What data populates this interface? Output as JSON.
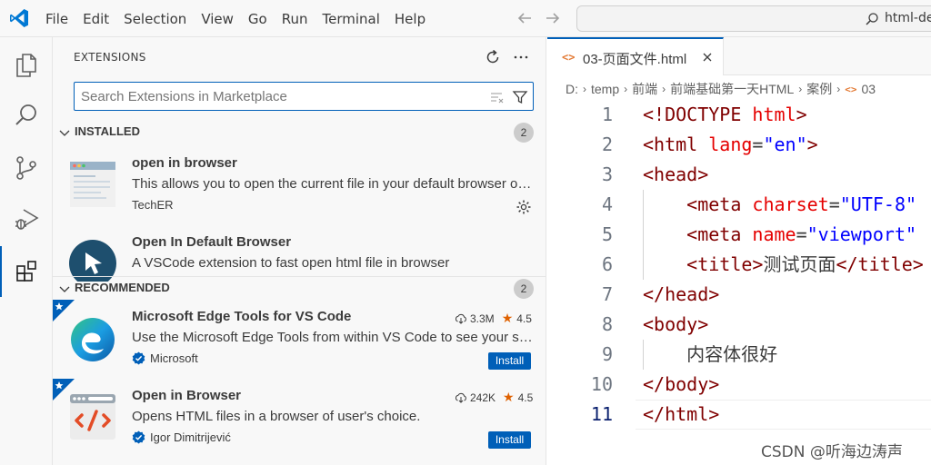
{
  "colors": {
    "accent": "#005fb8",
    "tag": "#800000",
    "attribute": "#e50000",
    "string": "#0000ff",
    "star": "#df6100"
  },
  "titlebar": {
    "menu": [
      "File",
      "Edit",
      "Selection",
      "View",
      "Go",
      "Run",
      "Terminal",
      "Help"
    ],
    "command_center_text": "html-de"
  },
  "activity_bar": [
    "explorer-icon",
    "search-icon",
    "source-control-icon",
    "run-debug-icon",
    "extensions-icon"
  ],
  "sidebar": {
    "title": "EXTENSIONS",
    "search_placeholder": "Search Extensions in Marketplace",
    "installed": {
      "title": "INSTALLED",
      "count": "2",
      "items": [
        {
          "name": "open in browser",
          "description": "This allows you to open the current file in your default browser or application.",
          "publisher": "TechER"
        },
        {
          "name": "Open In Default Browser",
          "description": "A VSCode extension to fast open html file in browser",
          "publisher": ""
        }
      ]
    },
    "recommended": {
      "title": "RECOMMENDED",
      "count": "2",
      "items": [
        {
          "name": "Microsoft Edge Tools for VS Code",
          "description": "Use the Microsoft Edge Tools from within VS Code to see your site's runtime HTML structure",
          "publisher": "Microsoft",
          "downloads": "3.3M",
          "rating": "4.5",
          "button": "Install"
        },
        {
          "name": "Open in Browser",
          "description": "Opens HTML files in a browser of user's choice.",
          "publisher": "Igor Dimitrijević",
          "downloads": "242K",
          "rating": "4.5",
          "button": "Install"
        }
      ]
    }
  },
  "editor": {
    "tab": {
      "icon": "<>",
      "label": "03-页面文件.html"
    },
    "breadcrumb": [
      "D:",
      "temp",
      "前端",
      "前端基础第一天HTML",
      "案例",
      "03"
    ],
    "current_line": 11,
    "lines": [
      {
        "n": "1",
        "tokens": [
          [
            "tag",
            "<!DOCTYPE "
          ],
          [
            "attr",
            "html"
          ],
          [
            "tag",
            ">"
          ]
        ]
      },
      {
        "n": "2",
        "tokens": [
          [
            "tag",
            "<html "
          ],
          [
            "attr",
            "lang"
          ],
          [
            "txt",
            "="
          ],
          [
            "str",
            "\"en\""
          ],
          [
            "tag",
            ">"
          ]
        ]
      },
      {
        "n": "3",
        "tokens": [
          [
            "tag",
            "<head>"
          ]
        ]
      },
      {
        "n": "4",
        "tokens": [
          [
            "txt",
            "    "
          ],
          [
            "tag",
            "<meta "
          ],
          [
            "attr",
            "charset"
          ],
          [
            "txt",
            "="
          ],
          [
            "str",
            "\"UTF-8\""
          ]
        ]
      },
      {
        "n": "5",
        "tokens": [
          [
            "txt",
            "    "
          ],
          [
            "tag",
            "<meta "
          ],
          [
            "attr",
            "name"
          ],
          [
            "txt",
            "="
          ],
          [
            "str",
            "\"viewport\""
          ]
        ]
      },
      {
        "n": "6",
        "tokens": [
          [
            "txt",
            "    "
          ],
          [
            "tag",
            "<title>"
          ],
          [
            "txt",
            "测试页面"
          ],
          [
            "tag",
            "</title>"
          ]
        ]
      },
      {
        "n": "7",
        "tokens": [
          [
            "tag",
            "</head>"
          ]
        ]
      },
      {
        "n": "8",
        "tokens": [
          [
            "tag",
            "<body>"
          ]
        ]
      },
      {
        "n": "9",
        "tokens": [
          [
            "txt",
            "    内容体很好"
          ]
        ]
      },
      {
        "n": "10",
        "tokens": [
          [
            "tag",
            "</body>"
          ]
        ]
      },
      {
        "n": "11",
        "tokens": [
          [
            "tag",
            "</html>"
          ]
        ]
      }
    ]
  },
  "watermark": "CSDN @听海边涛声"
}
